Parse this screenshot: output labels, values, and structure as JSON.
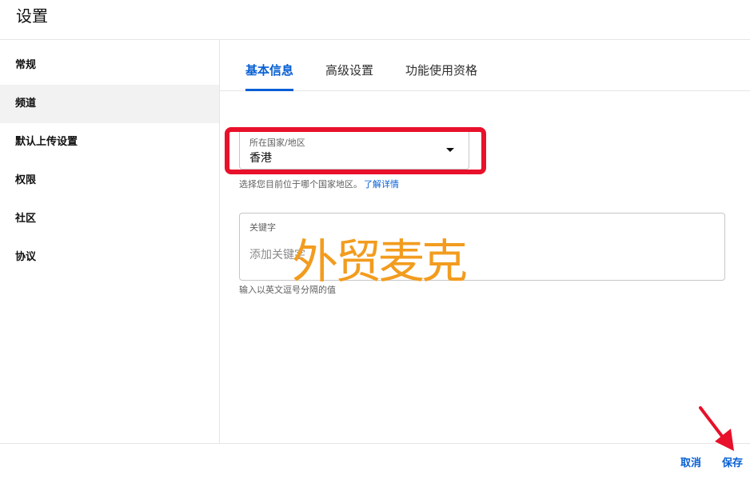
{
  "header": {
    "title": "设置"
  },
  "sidebar": {
    "items": [
      {
        "label": "常规"
      },
      {
        "label": "频道"
      },
      {
        "label": "默认上传设置"
      },
      {
        "label": "权限"
      },
      {
        "label": "社区"
      },
      {
        "label": "协议"
      }
    ]
  },
  "tabs": [
    {
      "label": "基本信息"
    },
    {
      "label": "高级设置"
    },
    {
      "label": "功能使用资格"
    }
  ],
  "country": {
    "label": "所在国家/地区",
    "value": "香港",
    "helper": "选择您目前位于哪个国家地区。",
    "learn_more": "了解详情"
  },
  "keywords": {
    "label": "关键字",
    "placeholder": "添加关键字",
    "helper": "输入以英文逗号分隔的值"
  },
  "watermark": {
    "text": "外贸麦克"
  },
  "footer": {
    "cancel_label": "取消",
    "save_label": "保存"
  },
  "colors": {
    "accent": "#065fd4",
    "highlight": "#e8102a",
    "watermark": "#f29c1f",
    "sidebar_active_bg": "#f2f2f2"
  },
  "icons": {
    "dropdown": "caret-down-icon",
    "annotation_arrow": "arrow-icon"
  }
}
